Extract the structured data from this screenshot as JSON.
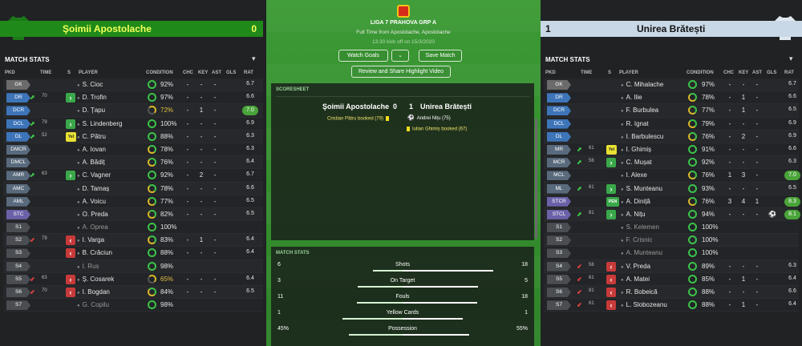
{
  "left": {
    "team": "Şoimii Apostolache",
    "score": "0",
    "section": "MATCH STATS",
    "headers": [
      "PKD",
      "TIME",
      "S",
      "PLAYER",
      "CONDITION",
      "CHC",
      "KEY",
      "AST",
      "GLS",
      "RAT"
    ],
    "players": [
      {
        "pos": "GK",
        "cat": "gk",
        "time": "",
        "arrow": "",
        "sbtn": "",
        "name": "S. Cioc",
        "cond": "92%",
        "ring": "full",
        "chc": "-",
        "key": "-",
        "ast": "-",
        "gls": "",
        "rat": "6.7",
        "good": false,
        "sub": false,
        "ball": false
      },
      {
        "pos": "DR",
        "cat": "def",
        "time": "70",
        "arrow": "up",
        "sbtn": "on",
        "name": "D. Trofin",
        "cond": "97%",
        "ring": "full",
        "chc": "-",
        "key": "-",
        "ast": "-",
        "gls": "",
        "rat": "6.6",
        "good": false,
        "sub": false,
        "ball": false
      },
      {
        "pos": "DCR",
        "cat": "def",
        "time": "",
        "arrow": "",
        "sbtn": "",
        "name": "D. Țapu",
        "cond": "72%",
        "ring": "yel",
        "chc": "-",
        "key": "1",
        "ast": "-",
        "gls": "",
        "rat": "7.0",
        "good": true,
        "sub": false,
        "ball": false
      },
      {
        "pos": "DCL",
        "cat": "def",
        "time": "79",
        "arrow": "up",
        "sbtn": "on",
        "name": "S. Lindenberg",
        "cond": "100%",
        "ring": "full",
        "chc": "-",
        "key": "-",
        "ast": "-",
        "gls": "",
        "rat": "6.9",
        "good": false,
        "sub": false,
        "ball": false
      },
      {
        "pos": "DL",
        "cat": "def",
        "time": "52",
        "arrow": "up",
        "sbtn": "yel",
        "name": "C. Pătru",
        "cond": "88%",
        "ring": "full",
        "chc": "-",
        "key": "-",
        "ast": "-",
        "gls": "",
        "rat": "6.3",
        "good": false,
        "sub": false,
        "ball": false
      },
      {
        "pos": "DMCR",
        "cat": "mid",
        "time": "",
        "arrow": "",
        "sbtn": "",
        "name": "A. Iovan",
        "cond": "78%",
        "ring": "half",
        "chc": "-",
        "key": "-",
        "ast": "-",
        "gls": "",
        "rat": "6.3",
        "good": false,
        "sub": false,
        "ball": false
      },
      {
        "pos": "DMCL",
        "cat": "mid",
        "time": "",
        "arrow": "",
        "sbtn": "",
        "name": "A. Bădiț",
        "cond": "76%",
        "ring": "half",
        "chc": "-",
        "key": "-",
        "ast": "-",
        "gls": "",
        "rat": "6.4",
        "good": false,
        "sub": false,
        "ball": false
      },
      {
        "pos": "AMR",
        "cat": "mid",
        "time": "63",
        "arrow": "up",
        "sbtn": "on",
        "name": "C. Vagner",
        "cond": "92%",
        "ring": "full",
        "chc": "-",
        "key": "2",
        "ast": "-",
        "gls": "",
        "rat": "6.7",
        "good": false,
        "sub": false,
        "ball": false
      },
      {
        "pos": "AMC",
        "cat": "mid",
        "time": "",
        "arrow": "",
        "sbtn": "",
        "name": "D. Tamaș",
        "cond": "78%",
        "ring": "half",
        "chc": "-",
        "key": "-",
        "ast": "-",
        "gls": "",
        "rat": "6.6",
        "good": false,
        "sub": false,
        "ball": false
      },
      {
        "pos": "AML",
        "cat": "mid",
        "time": "",
        "arrow": "",
        "sbtn": "",
        "name": "A. Voicu",
        "cond": "77%",
        "ring": "half",
        "chc": "-",
        "key": "-",
        "ast": "-",
        "gls": "",
        "rat": "6.5",
        "good": false,
        "sub": false,
        "ball": false
      },
      {
        "pos": "STC",
        "cat": "att",
        "time": "",
        "arrow": "",
        "sbtn": "",
        "name": "O. Preda",
        "cond": "82%",
        "ring": "half",
        "chc": "-",
        "key": "-",
        "ast": "-",
        "gls": "",
        "rat": "6.5",
        "good": false,
        "sub": false,
        "ball": false
      },
      {
        "pos": "S1",
        "cat": "res",
        "time": "",
        "arrow": "",
        "sbtn": "",
        "name": "A. Oprea",
        "cond": "100%",
        "ring": "full",
        "chc": "",
        "key": "",
        "ast": "",
        "gls": "",
        "rat": "",
        "good": false,
        "sub": true,
        "ball": false
      },
      {
        "pos": "S2",
        "cat": "res",
        "time": "79",
        "arrow": "down",
        "sbtn": "off",
        "name": "I. Varga",
        "cond": "83%",
        "ring": "half",
        "chc": "-",
        "key": "1",
        "ast": "-",
        "gls": "",
        "rat": "6.4",
        "good": false,
        "sub": false,
        "ball": false
      },
      {
        "pos": "S3",
        "cat": "res",
        "time": "",
        "arrow": "",
        "sbtn": "off",
        "name": "B. Crăciun",
        "cond": "88%",
        "ring": "full",
        "chc": "-",
        "key": "-",
        "ast": "-",
        "gls": "",
        "rat": "6.4",
        "good": false,
        "sub": false,
        "ball": false
      },
      {
        "pos": "S4",
        "cat": "res",
        "time": "",
        "arrow": "",
        "sbtn": "",
        "name": "I. Rus",
        "cond": "98%",
        "ring": "full",
        "chc": "",
        "key": "",
        "ast": "",
        "gls": "",
        "rat": "",
        "good": false,
        "sub": true,
        "ball": false
      },
      {
        "pos": "S5",
        "cat": "res",
        "time": "63",
        "arrow": "down",
        "sbtn": "off",
        "name": "Ș. Cosarek",
        "cond": "65%",
        "ring": "yel",
        "chc": "-",
        "key": "-",
        "ast": "-",
        "gls": "",
        "rat": "6.4",
        "good": false,
        "sub": false,
        "ball": false
      },
      {
        "pos": "S6",
        "cat": "res",
        "time": "70",
        "arrow": "down",
        "sbtn": "off",
        "name": "I. Bogdan",
        "cond": "84%",
        "ring": "half",
        "chc": "-",
        "key": "-",
        "ast": "-",
        "gls": "",
        "rat": "6.5",
        "good": false,
        "sub": false,
        "ball": false
      },
      {
        "pos": "S7",
        "cat": "res",
        "time": "",
        "arrow": "",
        "sbtn": "",
        "name": "G. Copilu",
        "cond": "98%",
        "ring": "full",
        "chc": "",
        "key": "",
        "ast": "",
        "gls": "",
        "rat": "",
        "good": false,
        "sub": true,
        "ball": false
      }
    ]
  },
  "right": {
    "team": "Unirea Brătești",
    "score": "1",
    "section": "MATCH STATS",
    "headers": [
      "PKD",
      "TIME",
      "S",
      "PLAYER",
      "CONDITION",
      "CHC",
      "KEY",
      "AST",
      "GLS",
      "RAT"
    ],
    "players": [
      {
        "pos": "GK",
        "cat": "gk",
        "time": "",
        "arrow": "",
        "sbtn": "",
        "name": "C. Mihalache",
        "cond": "97%",
        "ring": "full",
        "chc": "-",
        "key": "-",
        "ast": "-",
        "gls": "",
        "rat": "6.7",
        "good": false,
        "sub": false,
        "ball": false
      },
      {
        "pos": "DR",
        "cat": "def",
        "time": "",
        "arrow": "",
        "sbtn": "",
        "name": "A. Ilie",
        "cond": "78%",
        "ring": "half",
        "chc": "-",
        "key": "1",
        "ast": "-",
        "gls": "",
        "rat": "6.6",
        "good": false,
        "sub": false,
        "ball": false
      },
      {
        "pos": "DCR",
        "cat": "def",
        "time": "",
        "arrow": "",
        "sbtn": "",
        "name": "F. Burbulea",
        "cond": "77%",
        "ring": "half",
        "chc": "-",
        "key": "1",
        "ast": "-",
        "gls": "",
        "rat": "6.5",
        "good": false,
        "sub": false,
        "ball": false
      },
      {
        "pos": "DCL",
        "cat": "def",
        "time": "",
        "arrow": "",
        "sbtn": "",
        "name": "R. Ignat",
        "cond": "79%",
        "ring": "half",
        "chc": "-",
        "key": "-",
        "ast": "-",
        "gls": "",
        "rat": "6.9",
        "good": false,
        "sub": false,
        "ball": false
      },
      {
        "pos": "DL",
        "cat": "def",
        "time": "",
        "arrow": "",
        "sbtn": "",
        "name": "I. Barbulescu",
        "cond": "76%",
        "ring": "half",
        "chc": "-",
        "key": "2",
        "ast": "-",
        "gls": "",
        "rat": "6.9",
        "good": false,
        "sub": false,
        "ball": false
      },
      {
        "pos": "MR",
        "cat": "mid",
        "time": "61",
        "arrow": "up",
        "sbtn": "yel",
        "name": "I. Ghimiș",
        "cond": "91%",
        "ring": "full",
        "chc": "-",
        "key": "-",
        "ast": "-",
        "gls": "",
        "rat": "6.6",
        "good": false,
        "sub": false,
        "ball": false
      },
      {
        "pos": "MCR",
        "cat": "mid",
        "time": "56",
        "arrow": "up",
        "sbtn": "on",
        "name": "C. Mușat",
        "cond": "92%",
        "ring": "full",
        "chc": "-",
        "key": "-",
        "ast": "-",
        "gls": "",
        "rat": "6.3",
        "good": false,
        "sub": false,
        "ball": false
      },
      {
        "pos": "MCL",
        "cat": "mid",
        "time": "",
        "arrow": "",
        "sbtn": "",
        "name": "I. Alexe",
        "cond": "76%",
        "ring": "half",
        "chc": "1",
        "key": "3",
        "ast": "-",
        "gls": "",
        "rat": "7.0",
        "good": true,
        "sub": false,
        "ball": false
      },
      {
        "pos": "ML",
        "cat": "mid",
        "time": "61",
        "arrow": "up",
        "sbtn": "on",
        "name": "S. Munteanu",
        "cond": "93%",
        "ring": "full",
        "chc": "-",
        "key": "-",
        "ast": "-",
        "gls": "",
        "rat": "6.5",
        "good": false,
        "sub": false,
        "ball": false
      },
      {
        "pos": "STCR",
        "cat": "att",
        "time": "",
        "arrow": "",
        "sbtn": "pen",
        "name": "A. Diniță",
        "cond": "76%",
        "ring": "half",
        "chc": "3",
        "key": "4",
        "ast": "1",
        "gls": "",
        "rat": "8.3",
        "good": true,
        "sub": false,
        "ball": false
      },
      {
        "pos": "STCL",
        "cat": "att",
        "time": "81",
        "arrow": "up",
        "sbtn": "on",
        "name": "A. Nițu",
        "cond": "94%",
        "ring": "full",
        "chc": "-",
        "key": "-",
        "ast": "-",
        "gls": "",
        "rat": "8.1",
        "good": true,
        "sub": false,
        "ball": true
      },
      {
        "pos": "S1",
        "cat": "res",
        "time": "",
        "arrow": "",
        "sbtn": "",
        "name": "S. Kelemen",
        "cond": "100%",
        "ring": "full",
        "chc": "",
        "key": "",
        "ast": "",
        "gls": "",
        "rat": "",
        "good": false,
        "sub": true,
        "ball": false
      },
      {
        "pos": "S2",
        "cat": "res",
        "time": "",
        "arrow": "",
        "sbtn": "",
        "name": "F. Crisnic",
        "cond": "100%",
        "ring": "full",
        "chc": "",
        "key": "",
        "ast": "",
        "gls": "",
        "rat": "",
        "good": false,
        "sub": true,
        "ball": false
      },
      {
        "pos": "S3",
        "cat": "res",
        "time": "",
        "arrow": "",
        "sbtn": "",
        "name": "A. Munteanu",
        "cond": "100%",
        "ring": "full",
        "chc": "",
        "key": "",
        "ast": "",
        "gls": "",
        "rat": "",
        "good": false,
        "sub": true,
        "ball": false
      },
      {
        "pos": "S4",
        "cat": "res",
        "time": "56",
        "arrow": "down",
        "sbtn": "off",
        "name": "V. Preda",
        "cond": "89%",
        "ring": "full",
        "chc": "-",
        "key": "-",
        "ast": "-",
        "gls": "",
        "rat": "6.3",
        "good": false,
        "sub": false,
        "ball": false
      },
      {
        "pos": "S5",
        "cat": "res",
        "time": "61",
        "arrow": "down",
        "sbtn": "off",
        "name": "A. Matei",
        "cond": "85%",
        "ring": "full",
        "chc": "-",
        "key": "1",
        "ast": "-",
        "gls": "",
        "rat": "6.4",
        "good": false,
        "sub": false,
        "ball": false
      },
      {
        "pos": "S6",
        "cat": "res",
        "time": "81",
        "arrow": "down",
        "sbtn": "off",
        "name": "R. Bobeică",
        "cond": "88%",
        "ring": "full",
        "chc": "-",
        "key": "-",
        "ast": "-",
        "gls": "",
        "rat": "6.6",
        "good": false,
        "sub": false,
        "ball": false
      },
      {
        "pos": "S7",
        "cat": "res",
        "time": "61",
        "arrow": "down",
        "sbtn": "off",
        "name": "L. Slobozeanu",
        "cond": "88%",
        "ring": "full",
        "chc": "-",
        "key": "1",
        "ast": "-",
        "gls": "",
        "rat": "6.4",
        "good": false,
        "sub": false,
        "ball": false
      }
    ]
  },
  "center": {
    "league": "LIGA 7 PRAHOVA GRP A",
    "result": "Full Time from Apostolache, Apostolache",
    "kickoff": "13:30 kick off on 15/3/2020",
    "watch_goals": "Watch Goals",
    "save_match": "Save Match",
    "review_share": "Review and Share Highlight Video",
    "scoresheet_title": "SCORESHEET",
    "home_team": "Şoimii Apostolache",
    "home_score": "0",
    "away_score": "1",
    "away_team": "Unirea Brătești",
    "home_events": [
      "Cristian Pătru booked (79)"
    ],
    "away_events": [
      {
        "icon": "ball",
        "text": "Andrei Nițu (75)"
      },
      {
        "icon": "card",
        "text": "Iulian Ghimiș booked (67)"
      }
    ],
    "stats_title": "MATCH STATS",
    "stats": [
      {
        "name": "Shots",
        "home": "6",
        "away": "18",
        "hv": 6,
        "av": 18
      },
      {
        "name": "On Target",
        "home": "3",
        "away": "5",
        "hv": 3,
        "av": 5
      },
      {
        "name": "Fouls",
        "home": "11",
        "away": "18",
        "hv": 11,
        "av": 18
      },
      {
        "name": "Yellow Cards",
        "home": "1",
        "away": "1",
        "hv": 1,
        "av": 1
      },
      {
        "name": "Possession",
        "home": "45%",
        "away": "55%",
        "hv": 45,
        "av": 55
      }
    ]
  },
  "colors": {
    "home_bar": "#1f8a1a",
    "home_text": "#f2ff59",
    "away_bar": "#c8d8e6",
    "good_rating": "#4aa43a"
  }
}
